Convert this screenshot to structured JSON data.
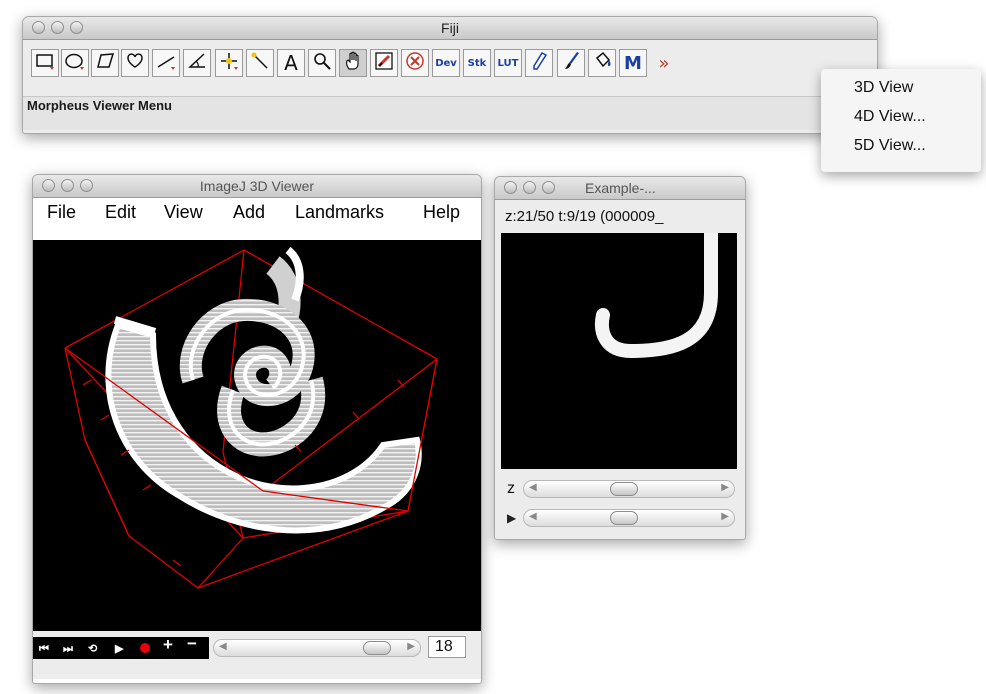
{
  "fiji": {
    "title": "Fiji",
    "status": "Morpheus Viewer Menu",
    "tools": [
      {
        "name": "rectangle-tool-icon",
        "label": ""
      },
      {
        "name": "oval-tool-icon",
        "label": ""
      },
      {
        "name": "polygon-tool-icon",
        "label": ""
      },
      {
        "name": "freehand-tool-icon",
        "label": ""
      },
      {
        "name": "line-tool-icon",
        "label": ""
      },
      {
        "name": "angle-tool-icon",
        "label": ""
      },
      {
        "name": "point-tool-icon",
        "label": ""
      },
      {
        "name": "wand-tool-icon",
        "label": ""
      },
      {
        "name": "text-tool-icon",
        "label": "A"
      },
      {
        "name": "magnifier-tool-icon",
        "label": ""
      },
      {
        "name": "hand-tool-icon",
        "label": ""
      },
      {
        "name": "color-picker-tool-icon",
        "label": ""
      },
      {
        "name": "stop-tool-icon",
        "label": ""
      },
      {
        "name": "dev-menu-icon",
        "label": "Dev"
      },
      {
        "name": "stk-menu-icon",
        "label": "Stk"
      },
      {
        "name": "lut-menu-icon",
        "label": "LUT"
      },
      {
        "name": "pencil-tool-icon",
        "label": ""
      },
      {
        "name": "brush-tool-icon",
        "label": ""
      },
      {
        "name": "flood-fill-tool-icon",
        "label": ""
      },
      {
        "name": "morpheus-tool-icon",
        "label": "M"
      },
      {
        "name": "more-tools-icon",
        "label": "»"
      }
    ]
  },
  "dropdown": {
    "items": [
      "3D View",
      "4D View...",
      "5D View..."
    ]
  },
  "viewer3d": {
    "title": "ImageJ 3D Viewer",
    "menus": [
      "File",
      "Edit",
      "View",
      "Add",
      "Landmarks",
      "Help"
    ],
    "frame_value": "18"
  },
  "example": {
    "title": "Example-...",
    "info": "z:21/50 t:9/19 (000009_",
    "z_label": "z"
  },
  "colors": {
    "record": "#e8000d",
    "bounding_box": "#e00000",
    "toolbar_accent": "#c0392b"
  }
}
